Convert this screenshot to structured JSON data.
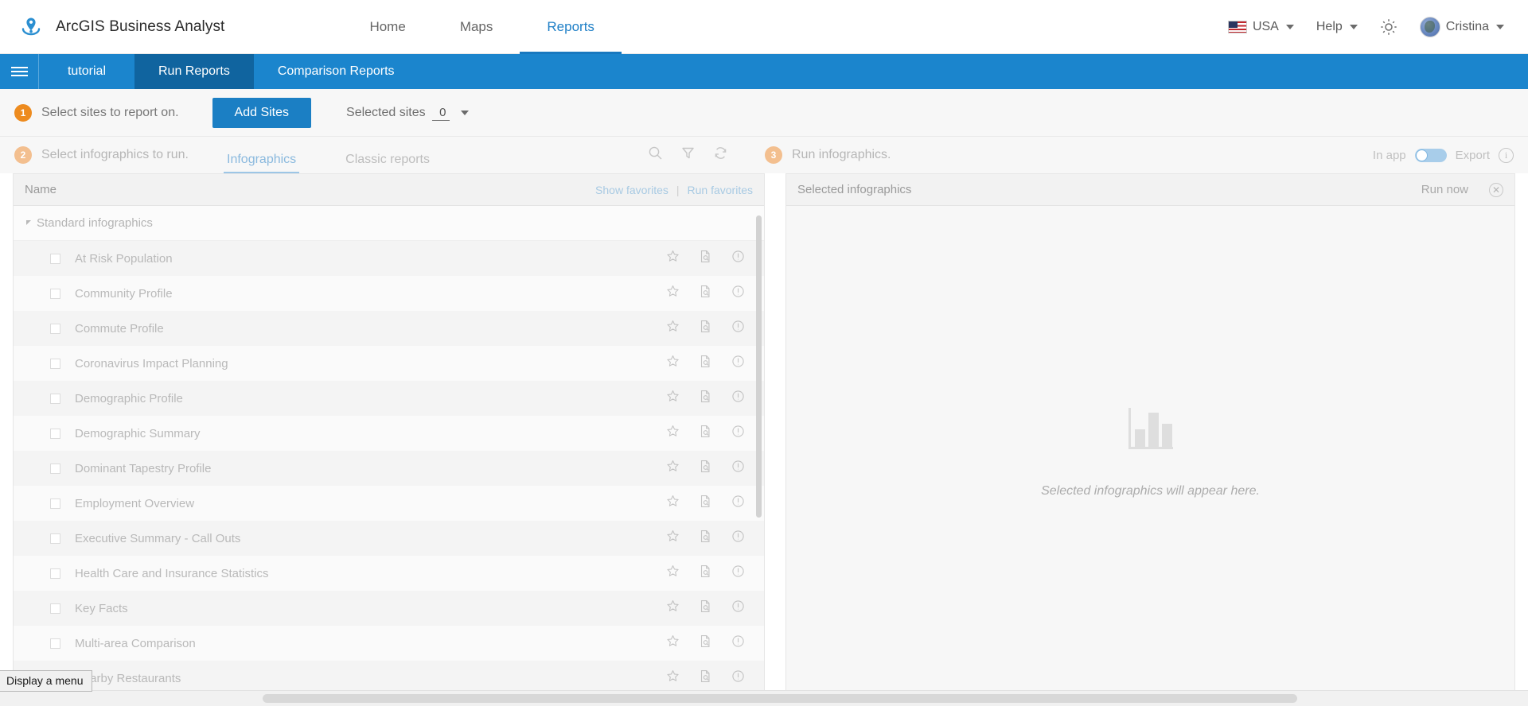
{
  "header": {
    "brand": "ArcGIS Business Analyst",
    "logo_icon": "location-pin-icon",
    "nav": [
      {
        "label": "Home",
        "active": false
      },
      {
        "label": "Maps",
        "active": false
      },
      {
        "label": "Reports",
        "active": true
      }
    ],
    "region": {
      "label": "USA",
      "flag_icon": "usa-flag-icon"
    },
    "help": {
      "label": "Help"
    },
    "settings_icon": "gear-icon",
    "user": {
      "name": "Cristina",
      "avatar_icon": "user-avatar"
    }
  },
  "app_bar": {
    "menu_icon": "hamburger-menu-icon",
    "tabs": [
      {
        "label": "tutorial",
        "active": false
      },
      {
        "label": "Run Reports",
        "active": true
      },
      {
        "label": "Comparison Reports",
        "active": false
      }
    ]
  },
  "step1": {
    "number": "1",
    "label": "Select sites to report on.",
    "add_sites_label": "Add Sites",
    "selected_sites_label": "Selected sites",
    "selected_sites_count": "0"
  },
  "step2": {
    "number": "2",
    "label": "Select infographics to run.",
    "tabs": [
      {
        "label": "Infographics",
        "active": true
      },
      {
        "label": "Classic reports",
        "active": false
      }
    ],
    "tools": [
      {
        "icon": "search-icon"
      },
      {
        "icon": "filter-icon"
      },
      {
        "icon": "refresh-icon"
      }
    ]
  },
  "step3": {
    "number": "3",
    "label": "Run infographics.",
    "in_app_label": "In app",
    "export_label": "Export",
    "toggle_state": "off",
    "info_icon": "info-icon"
  },
  "left_panel": {
    "column_header": "Name",
    "show_favorites": "Show favorites",
    "separator": "|",
    "run_favorites": "Run favorites",
    "group": {
      "label": "Standard infographics",
      "expanded": true
    },
    "row_icons": [
      {
        "icon": "star-icon"
      },
      {
        "icon": "preview-document-icon"
      },
      {
        "icon": "info-icon"
      }
    ],
    "items": [
      {
        "name": "At Risk Population"
      },
      {
        "name": "Community Profile"
      },
      {
        "name": "Commute Profile"
      },
      {
        "name": "Coronavirus Impact Planning"
      },
      {
        "name": "Demographic Profile"
      },
      {
        "name": "Demographic Summary"
      },
      {
        "name": "Dominant Tapestry Profile"
      },
      {
        "name": "Employment Overview"
      },
      {
        "name": "Executive Summary - Call Outs"
      },
      {
        "name": "Health Care and Insurance Statistics"
      },
      {
        "name": "Key Facts"
      },
      {
        "name": "Multi-area Comparison"
      },
      {
        "name": "Nearby Restaurants"
      }
    ]
  },
  "right_panel": {
    "title": "Selected infographics",
    "run_now_label": "Run now",
    "close_icon": "close-circle-icon",
    "empty_icon": "bar-chart-icon",
    "empty_text": "Selected infographics will appear here."
  },
  "status_bar": {
    "tooltip": "Display a menu"
  },
  "colors": {
    "brand_blue": "#1b85cd",
    "active_tab_blue": "#10649f",
    "button_blue": "#1b7fc4",
    "step_orange": "#ed8b1f",
    "step_orange_faded": "#f3bf8f",
    "link_blue": "#a8cae3"
  }
}
